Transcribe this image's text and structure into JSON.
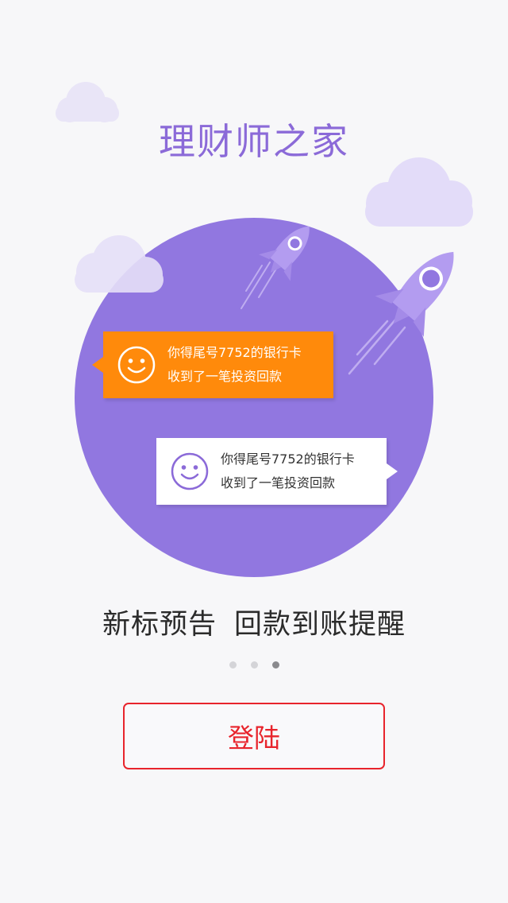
{
  "app": {
    "title": "理财师之家"
  },
  "colors": {
    "circle": "#9177e0",
    "orange_bubble": "#ff8a0b",
    "accent_purple": "#8b6ad8",
    "login_red": "#e8242c"
  },
  "notifications": [
    {
      "line1": "你得尾号7752的银行卡",
      "line2": "收到了一笔投资回款",
      "icon": "smiley-icon"
    },
    {
      "line1": "你得尾号7752的银行卡",
      "line2": "收到了一笔投资回款",
      "icon": "smiley-icon"
    }
  ],
  "tagline": {
    "part1": "新标预告",
    "part2": "回款到账提醒"
  },
  "pagination": {
    "total": 3,
    "current": 3
  },
  "login_button": {
    "label": "登陆"
  }
}
